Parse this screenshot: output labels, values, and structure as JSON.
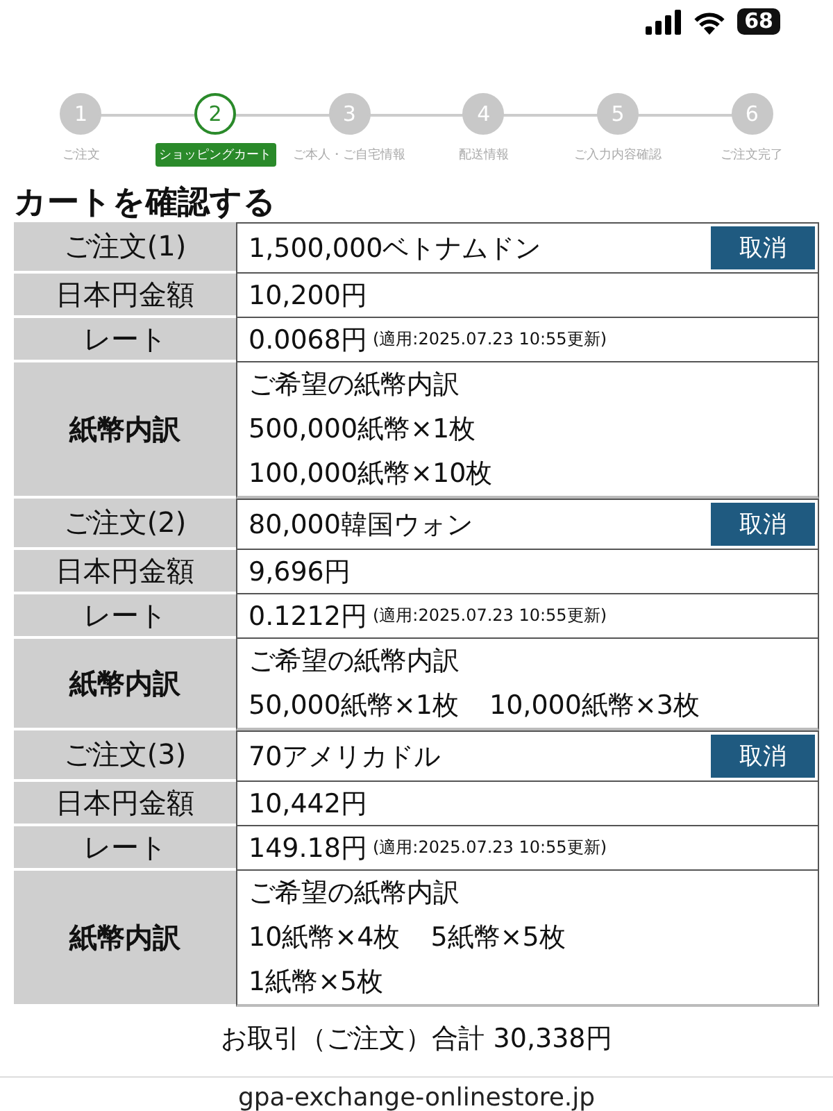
{
  "status_bar": {
    "battery": "68"
  },
  "steps": [
    {
      "number": "1",
      "label": "ご注文",
      "selected": false
    },
    {
      "number": "2",
      "label": "ショッピングカート",
      "selected": true
    },
    {
      "number": "3",
      "label": "ご本人・ご自宅情報",
      "selected": false
    },
    {
      "number": "4",
      "label": "配送情報",
      "selected": false
    },
    {
      "number": "5",
      "label": "ご入力内容確認",
      "selected": false
    },
    {
      "number": "6",
      "label": "ご注文完了",
      "selected": false
    }
  ],
  "title": "カートを確認する",
  "orders": [
    {
      "label": "ご注文(1)",
      "currency": "1,500,000ベトナムドン",
      "cancel": "取消",
      "yen_label": "日本円金額",
      "yen": "10,200円",
      "rate_label": "レート",
      "rate": "0.0068円",
      "rate_note": "(適用:2025.07.23 10:55更新)",
      "notes_label": "紙幣内訳",
      "notes_header": "ご希望の紙幣内訳",
      "notes_lines": [
        [
          "500,000紙幣×1枚"
        ],
        [
          "100,000紙幣×10枚"
        ]
      ]
    },
    {
      "label": "ご注文(2)",
      "currency": "80,000韓国ウォン",
      "cancel": "取消",
      "yen_label": "日本円金額",
      "yen": "9,696円",
      "rate_label": "レート",
      "rate": "0.1212円",
      "rate_note": "(適用:2025.07.23 10:55更新)",
      "notes_label": "紙幣内訳",
      "notes_header": "ご希望の紙幣内訳",
      "notes_lines": [
        [
          "50,000紙幣×1枚",
          "10,000紙幣×3枚"
        ]
      ]
    },
    {
      "label": "ご注文(3)",
      "currency": "70アメリカドル",
      "cancel": "取消",
      "yen_label": "日本円金額",
      "yen": "10,442円",
      "rate_label": "レート",
      "rate": "149.18円",
      "rate_note": "(適用:2025.07.23 10:55更新)",
      "notes_label": "紙幣内訳",
      "notes_header": "ご希望の紙幣内訳",
      "notes_lines": [
        [
          "10紙幣×4枚",
          "5紙幣×5枚"
        ],
        [
          "1紙幣×5枚"
        ]
      ]
    }
  ],
  "total": "お取引（ご注文）合計 30,338円",
  "url_bar": {
    "url": "gpa-exchange-onlinestore.jp"
  }
}
